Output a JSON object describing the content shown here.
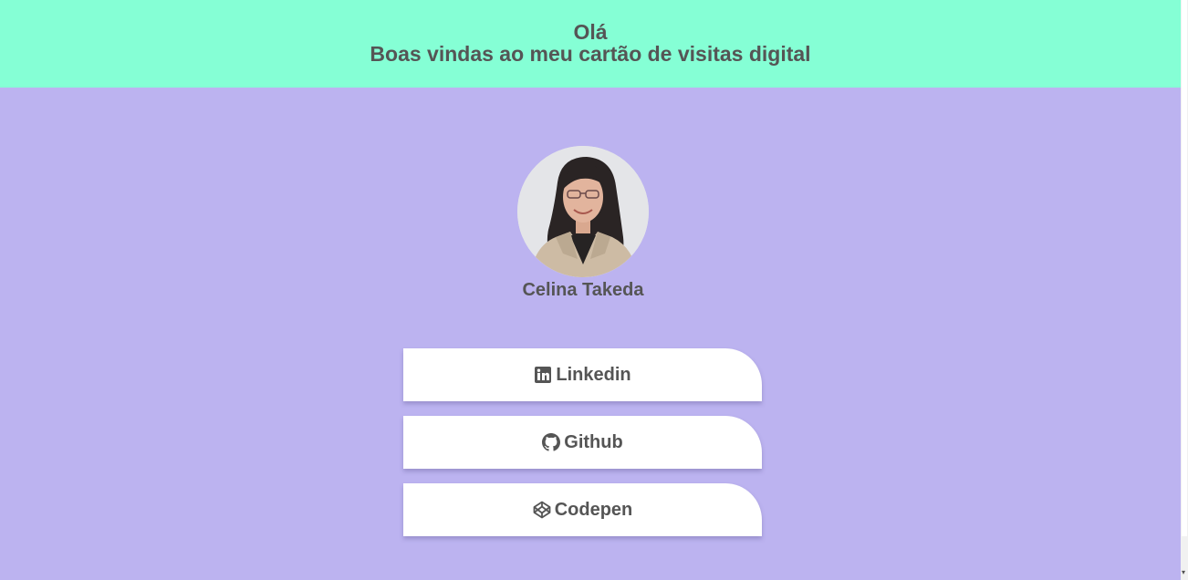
{
  "header": {
    "greeting": "Olá",
    "welcome": "Boas vindas ao meu cartão de visitas digital"
  },
  "profile": {
    "name": "Celina Takeda",
    "avatar_alt": "Foto de Celina Takeda"
  },
  "links": [
    {
      "label": "Linkedin",
      "icon": "linkedin-icon"
    },
    {
      "label": "Github",
      "icon": "github-icon"
    },
    {
      "label": "Codepen",
      "icon": "codepen-icon"
    }
  ],
  "colors": {
    "header_bg": "#85ffd5",
    "page_bg": "#bcb3f0",
    "text": "#555555",
    "button_bg": "#ffffff"
  }
}
